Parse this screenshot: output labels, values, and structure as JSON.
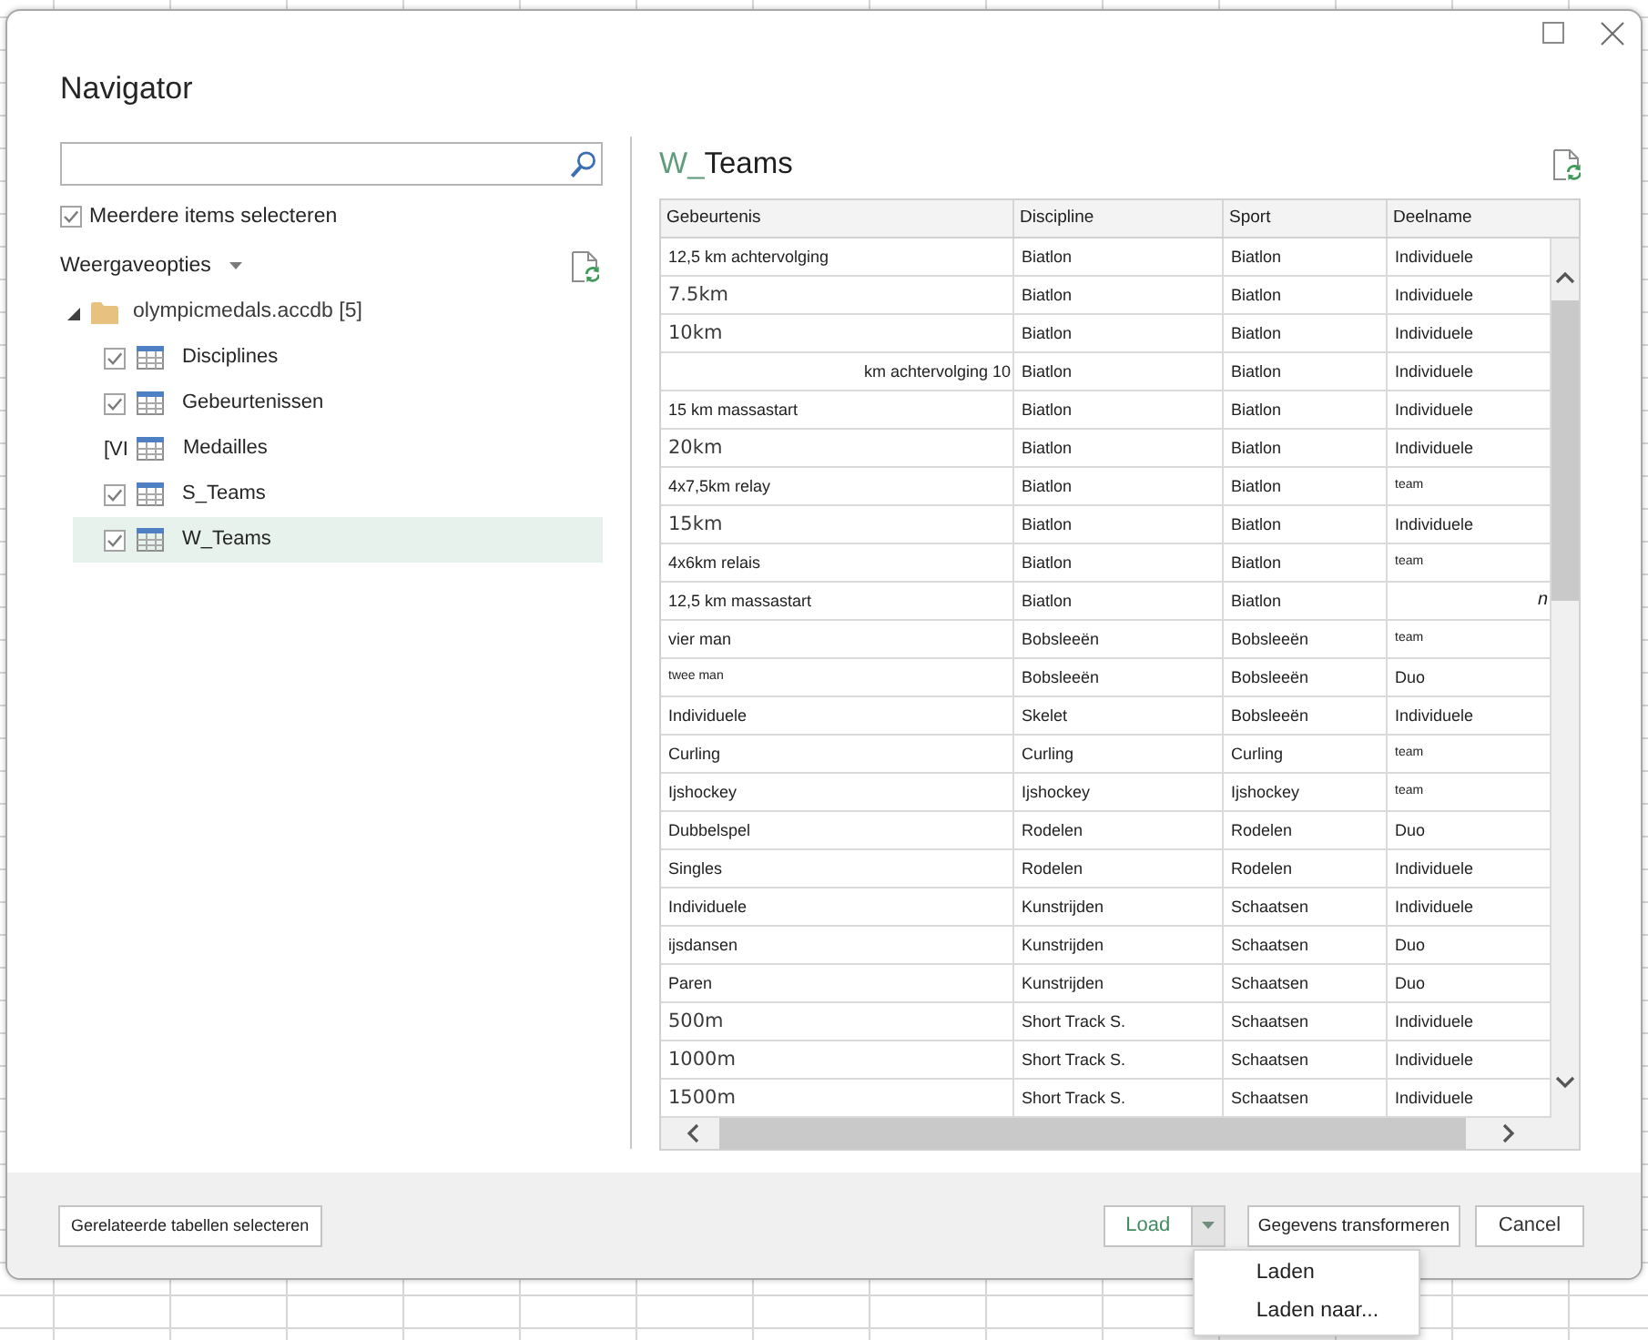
{
  "dialog": {
    "title": "Navigator"
  },
  "multi_select": {
    "label": "Meerdere items selecteren",
    "checked": true
  },
  "view_options": {
    "label": "Weergaveopties"
  },
  "tree": [
    {
      "label": "olympicmedals.accdb [5]",
      "expanded": true,
      "children": [
        {
          "label": "Disciplines",
          "kind": "checkbox",
          "checked": true,
          "selected": false
        },
        {
          "label": "Gebeurtenissen",
          "kind": "checkbox",
          "checked": true,
          "selected": false
        },
        {
          "label": "Medailles",
          "kind": "glyph",
          "glyph": "[VI",
          "selected": false
        },
        {
          "label": "S_Teams",
          "kind": "checkbox",
          "checked": true,
          "selected": false
        },
        {
          "label": "W_Teams",
          "kind": "checkbox",
          "checked": true,
          "selected": true
        }
      ]
    }
  ],
  "preview": {
    "title_parts": [
      {
        "text": "W_",
        "accent": true
      },
      {
        "text": "Teams",
        "accent": false
      }
    ],
    "columns": [
      "Gebeurtenis",
      "Discipline",
      "Sport",
      "Deelname"
    ],
    "rows": [
      [
        "12,5 km achtervolging",
        "Biatlon",
        "Biatlon",
        "Individuele"
      ],
      [
        {
          "text": "7.5km",
          "kind": "large"
        },
        "Biatlon",
        "Biatlon",
        "Individuele"
      ],
      [
        {
          "text": "10km",
          "kind": "large"
        },
        "Biatlon",
        "Biatlon",
        "Individuele"
      ],
      [
        {
          "text": "km achtervolging 10",
          "kind": "right"
        },
        "Biatlon",
        "Biatlon",
        "Individuele"
      ],
      [
        "15 km massastart",
        "Biatlon",
        "Biatlon",
        "Individuele"
      ],
      [
        {
          "text": "20km",
          "kind": "large"
        },
        "Biatlon",
        "Biatlon",
        "Individuele"
      ],
      [
        "4x7,5km relay",
        "Biatlon",
        "Biatlon",
        {
          "text": "team",
          "kind": "tiny"
        }
      ],
      [
        {
          "text": "15km",
          "kind": "large"
        },
        "Biatlon",
        "Biatlon",
        "Individuele"
      ],
      [
        "4x6km relais",
        "Biatlon",
        "Biatlon",
        {
          "text": "team",
          "kind": "tiny"
        }
      ],
      [
        "12,5 km massastart",
        "Biatlon",
        "Biatlon",
        {
          "text": "n",
          "kind": "edge-italic"
        }
      ],
      [
        "vier man",
        "Bobsleeën",
        "Bobsleeën",
        {
          "text": "team",
          "kind": "tiny"
        }
      ],
      [
        {
          "text": "twee man",
          "kind": "tiny"
        },
        "Bobsleeën",
        "Bobsleeën",
        "Duo"
      ],
      [
        "Individuele",
        "Skelet",
        "Bobsleeën",
        "Individuele"
      ],
      [
        "Curling",
        "Curling",
        "Curling",
        {
          "text": "team",
          "kind": "tiny"
        }
      ],
      [
        "Ijshockey",
        "Ijshockey",
        "Ijshockey",
        {
          "text": "team",
          "kind": "tiny"
        }
      ],
      [
        "Dubbelspel",
        "Rodelen",
        "Rodelen",
        "Duo"
      ],
      [
        "Singles",
        "Rodelen",
        "Rodelen",
        "Individuele"
      ],
      [
        "Individuele",
        "Kunstrijden",
        "Schaatsen",
        "Individuele"
      ],
      [
        "ijsdansen",
        "Kunstrijden",
        "Schaatsen",
        "Duo"
      ],
      [
        "Paren",
        "Kunstrijden",
        "Schaatsen",
        "Duo"
      ],
      [
        {
          "text": "500m",
          "kind": "large"
        },
        "Short Track S.",
        "Schaatsen",
        "Individuele"
      ],
      [
        {
          "text": "1000m",
          "kind": "large"
        },
        "Short Track S.",
        "Schaatsen",
        "Individuele"
      ],
      [
        {
          "text": "1500m",
          "kind": "large"
        },
        "Short Track S.",
        "Schaatsen",
        "Individuele"
      ]
    ]
  },
  "footer": {
    "related_button": "Gerelateerde tabellen selecteren",
    "load_button": {
      "label": "Load",
      "menu_open": true
    },
    "load_menu": [
      "Laden",
      "Laden naar..."
    ],
    "transform_button": "Gegevens transformeren",
    "cancel_button": "Cancel"
  }
}
